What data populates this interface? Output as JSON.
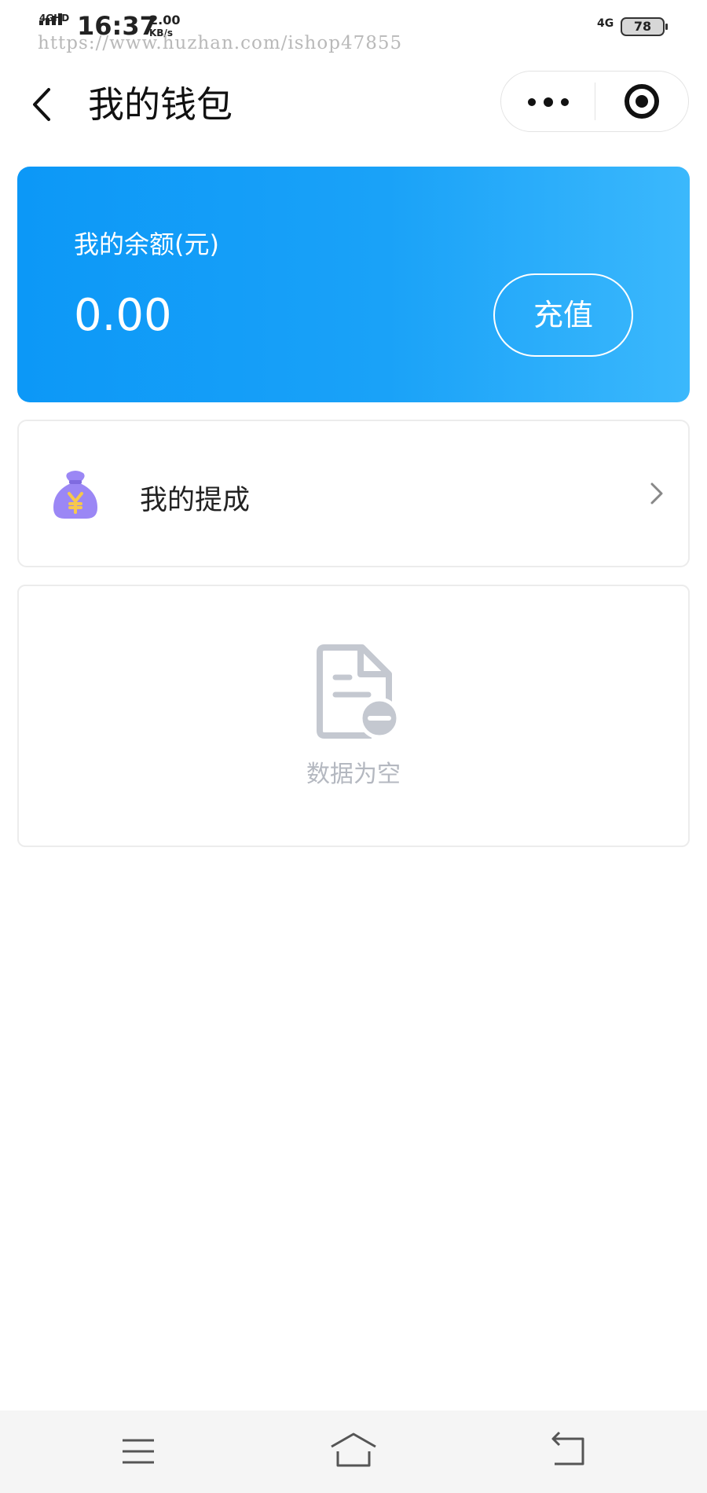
{
  "status_bar": {
    "network_left": "4GHD",
    "time": "16:37",
    "speed_value": "2.00",
    "speed_unit": "KB/s",
    "network_right": "4G",
    "battery": "78",
    "watermark": "https://www.huzhan.com/ishop47855"
  },
  "navbar": {
    "title": "我的钱包",
    "icons": {
      "back": "chevron-left-icon",
      "more": "more-dots-icon",
      "close": "target-close-icon"
    }
  },
  "balance": {
    "label": "我的余额(元)",
    "amount": "0.00",
    "recharge_label": "充值",
    "colors": {
      "gradient_start": "#0c98f7",
      "gradient_end": "#3bb8fc"
    }
  },
  "menu": {
    "commission": {
      "label": "我的提成",
      "icon": "money-bag-icon",
      "arrow": "chevron-right-icon",
      "icon_color": "#9b87f5",
      "symbol_color": "#f6c84c"
    }
  },
  "empty_state": {
    "icon": "document-minus-icon",
    "text": "数据为空",
    "icon_color": "#c4c8d0"
  },
  "system_nav": {
    "menu": "menu-icon",
    "home": "home-icon",
    "back": "back-icon"
  }
}
